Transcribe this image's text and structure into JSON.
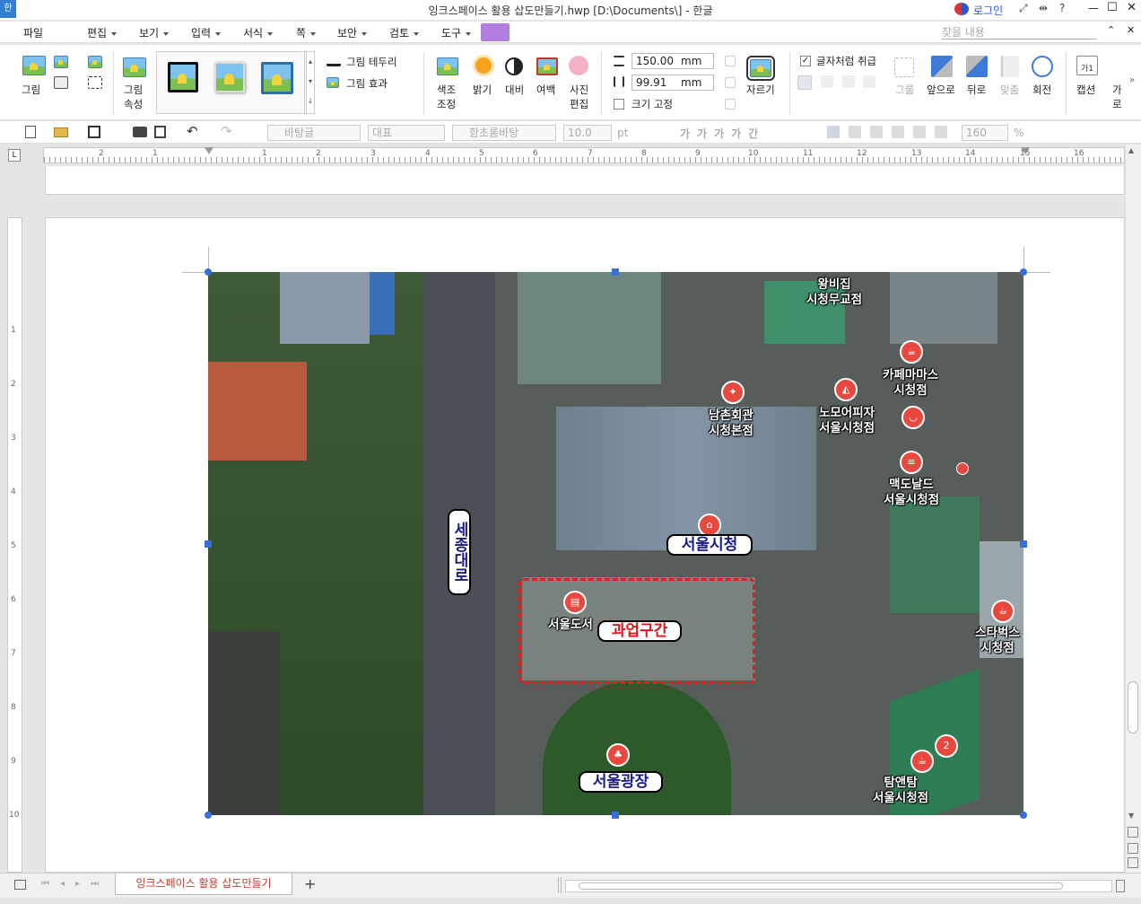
{
  "window": {
    "title": "잉크스페이스 활용 삽도만들기.hwp [D:\\Documents\\] - 한글",
    "app_icon": "한",
    "login": "로그인",
    "help": "?"
  },
  "menu": [
    "파일",
    "편집",
    "보기",
    "입력",
    "서식",
    "쪽",
    "보안",
    "검토",
    "도구"
  ],
  "search": {
    "placeholder": "찾을 내용"
  },
  "ribbon": {
    "picture": "그림",
    "picture_props": [
      "그림",
      "속성"
    ],
    "border": "그림 테두리",
    "effect": "그림 효과",
    "color_adjust": [
      "색조",
      "조정"
    ],
    "brightness": "밝기",
    "contrast": "대비",
    "margin": "여백",
    "photo_edit": [
      "사진",
      "편집"
    ],
    "width_value": "150.00",
    "height_value": "99.91",
    "unit": "mm",
    "keep_size": "크기 고정",
    "crop": "자르기",
    "treat_as_char": "글자처럼 취급",
    "group": "그룹",
    "bring_front": "앞으로",
    "send_back": "뒤로",
    "align": "맞춤",
    "rotate": "회전",
    "caption": "캡션",
    "more": [
      "가",
      "로"
    ]
  },
  "toolbar2": {
    "style": "바탕글",
    "category": "대표",
    "font": "함초롬바탕",
    "size": "10.0",
    "size_unit": "pt",
    "line_spacing": "160",
    "ls_unit": "%"
  },
  "ruler": {
    "h_numbers": [
      "2",
      "1",
      "1",
      "2",
      "3",
      "4",
      "5",
      "6",
      "7",
      "8",
      "9",
      "10",
      "11",
      "12",
      "13",
      "14",
      "15",
      "16"
    ],
    "v_numbers": [
      "1",
      "2",
      "3",
      "4",
      "5",
      "6",
      "7",
      "8",
      "9",
      "10"
    ]
  },
  "map": {
    "labels": [
      {
        "text": "왕비집\n시청무교점"
      },
      {
        "text": "카페마마스\n시청점"
      },
      {
        "text": "남촌회관\n시청본점"
      },
      {
        "text": "노모어피자\n서울시청점"
      },
      {
        "text": "맥도날드\n서울시청점"
      },
      {
        "text": "스타벅스\n시청점"
      },
      {
        "text": "서울도서"
      },
      {
        "text": "탐앤탐\n서울시청점"
      }
    ],
    "pills": {
      "city_hall": "서울시청",
      "plaza": "서울광장",
      "road": "세종대로",
      "work_zone": "과업구간"
    },
    "pin_number": "2"
  },
  "bottom": {
    "tab": "잉크스페이스 활용 삽도만들기",
    "add": "+"
  }
}
